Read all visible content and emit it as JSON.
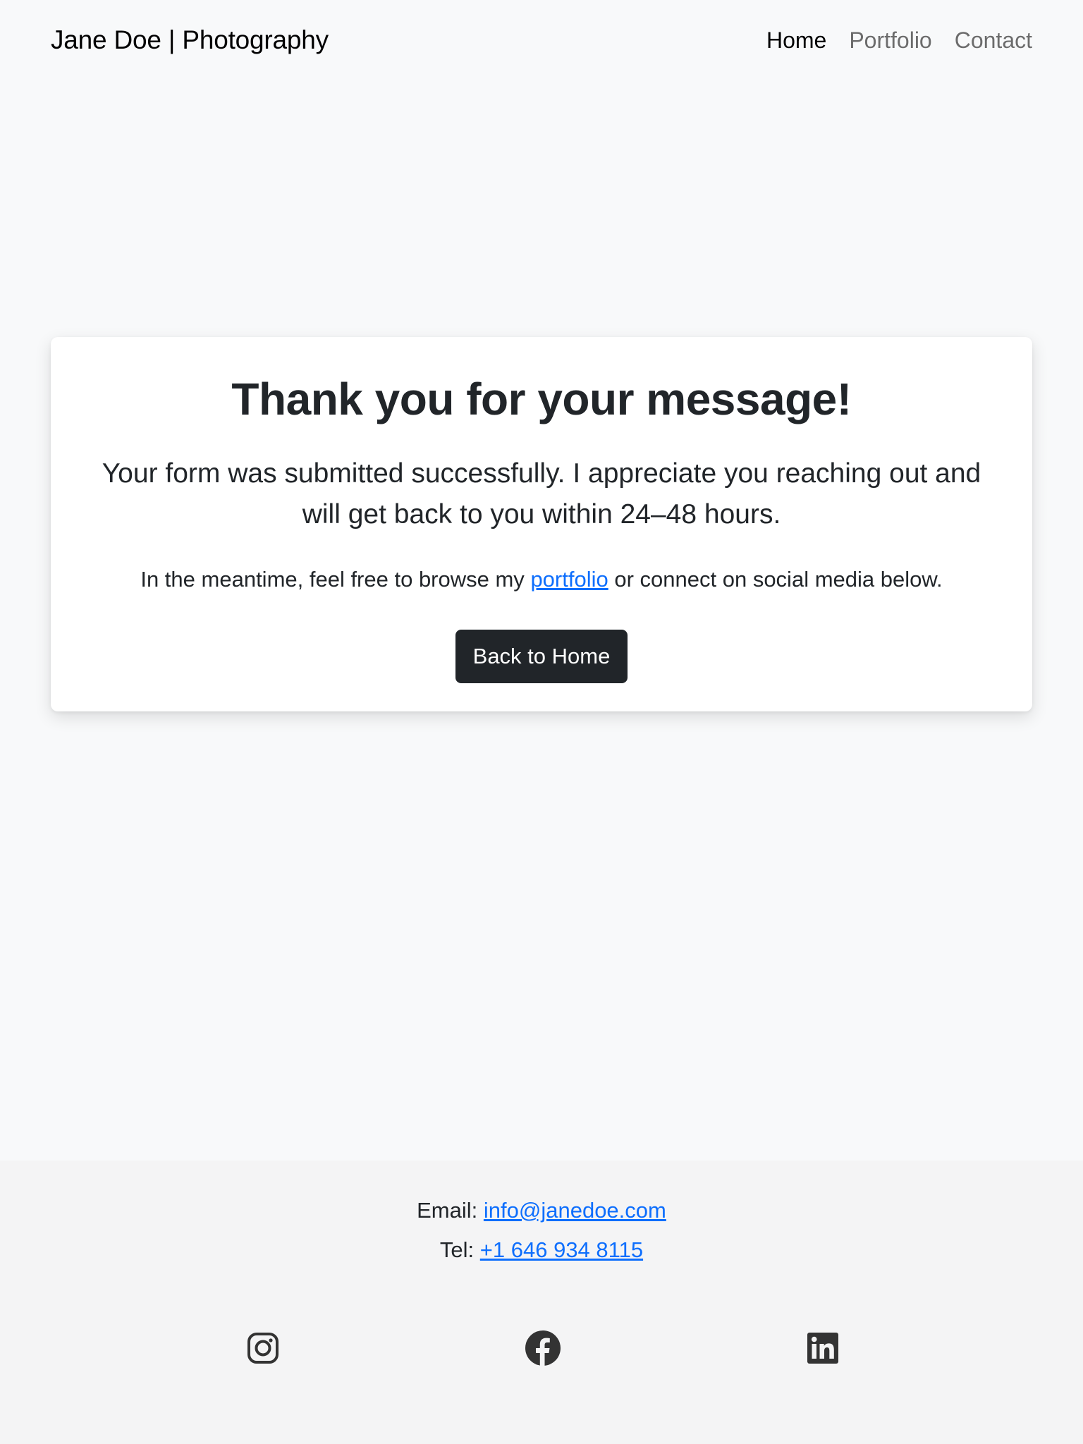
{
  "nav": {
    "brand": "Jane Doe | Photography",
    "links": [
      {
        "label": "Home",
        "active": true
      },
      {
        "label": "Portfolio",
        "active": false
      },
      {
        "label": "Contact",
        "active": false
      }
    ]
  },
  "card": {
    "title": "Thank you for your message!",
    "lead": "Your form was submitted successfully. I appreciate you reaching out and will get back to you within 24–48 hours.",
    "meantime_before": "In the meantime, feel free to browse my",
    "portfolio_link": "portfolio",
    "meantime_after": "or connect on social media below.",
    "button_label": "Back to Home"
  },
  "footer": {
    "email_label": "Email:",
    "email": "info@janedoe.com",
    "tel_label": "Tel:",
    "tel": "+1 646 934 8115",
    "socials": [
      {
        "icon": "instagram-icon"
      },
      {
        "icon": "facebook-icon"
      },
      {
        "icon": "linkedin-icon"
      }
    ]
  },
  "colors": {
    "page_bg": "#f8f9fa",
    "footer_bg": "#f4f4f5",
    "text": "#212529",
    "link": "#0d6efd",
    "button_bg": "#212529",
    "nav_inactive": "#6c6c6c"
  }
}
